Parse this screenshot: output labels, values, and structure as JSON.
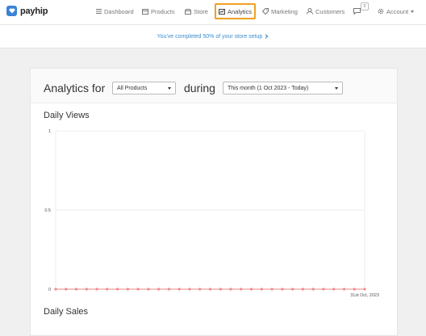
{
  "brand": {
    "name": "payhip"
  },
  "nav": {
    "dashboard": "Dashboard",
    "products": "Products",
    "store": "Store",
    "analytics": "Analytics",
    "marketing": "Marketing",
    "customers": "Customers",
    "notifications_count": "0",
    "account": "Account"
  },
  "setup_banner": {
    "text": "You've completed 50% of your store setup"
  },
  "analytics": {
    "label_for": "Analytics for",
    "product_select": "All Products",
    "label_during": "during",
    "period_select": "This month (1 Oct 2023 - Today)"
  },
  "colors": {
    "accent_blue": "#3b82d6",
    "highlight": "#f0a020",
    "line": "#f08a8a"
  },
  "chart_data": {
    "type": "line",
    "title": "Daily Views",
    "ylim": [
      0,
      1
    ],
    "yticks": [
      "1",
      "0.5",
      "0"
    ],
    "x_end_label": "31st Oct, 2023",
    "series": [
      {
        "values": [
          0,
          0,
          0,
          0,
          0,
          0,
          0,
          0,
          0,
          0,
          0,
          0,
          0,
          0,
          0,
          0,
          0,
          0,
          0,
          0,
          0,
          0,
          0,
          0,
          0,
          0,
          0,
          0,
          0,
          0,
          0
        ]
      }
    ]
  },
  "next_section": {
    "title": "Daily Sales"
  }
}
